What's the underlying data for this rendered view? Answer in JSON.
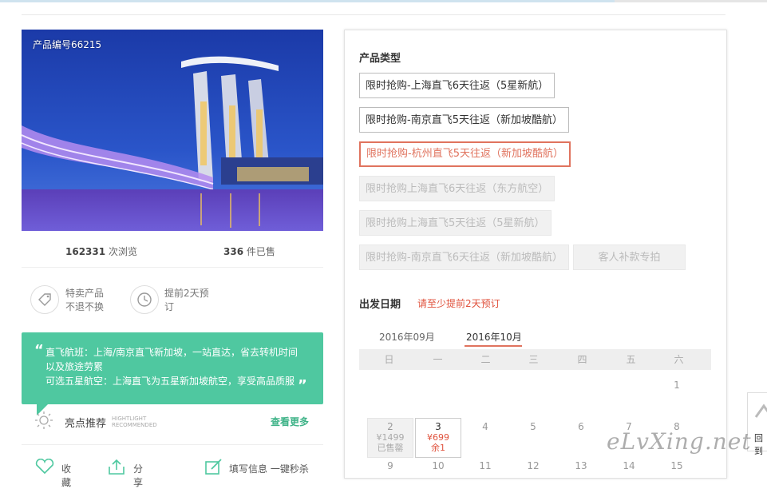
{
  "product": {
    "id_label": "产品编号66215",
    "views_count": "162331",
    "views_unit": "次浏览",
    "sold_count": "336",
    "sold_unit": "件已售"
  },
  "features": [
    {
      "icon": "tag-icon",
      "line1": "特卖产品",
      "line2": "不退不换"
    },
    {
      "icon": "clock-icon",
      "line1": "提前2天预",
      "line2": "订"
    }
  ],
  "highlight_quote": {
    "line1": "直飞航班：上海/南京直飞新加坡，一站直达，省去转机时间",
    "line2": "以及旅途劳累",
    "line3": "可选五星航空：上海直飞为五星新加坡航空，享受高品质服"
  },
  "highlights": {
    "title": "亮点推荐",
    "sub1": "HIGHTLIGHT",
    "sub2": "RECOMMENDED",
    "more_link": "查看更多"
  },
  "bottom_actions": {
    "favorite": "收藏",
    "share": "分享",
    "quick_fill": "填写信息 一键秒杀"
  },
  "product_type": {
    "title": "产品类型",
    "options": [
      {
        "label": "限时抢购-上海直飞6天往返（5星新航）",
        "state": "normal"
      },
      {
        "label": "限时抢购-南京直飞5天往返（新加坡酷航）",
        "state": "normal"
      },
      {
        "label": "限时抢购-杭州直飞5天往返（新加坡酷航）",
        "state": "selected"
      },
      {
        "label": "限时抢购上海直飞6天往返（东方航空）",
        "state": "disabled"
      },
      {
        "label": "限时抢购上海直飞5天往返（5星新航）",
        "state": "disabled"
      },
      {
        "label": "限时抢购-南京直飞6天往返（新加坡酷航）",
        "state": "disabled"
      },
      {
        "label": "客人补款专拍",
        "state": "disabled"
      }
    ]
  },
  "departure": {
    "title": "出发日期",
    "hint": "请至少提前2天预订",
    "months": [
      "2016年09月",
      "2016年10月"
    ],
    "active_month": "2016年10月",
    "weekdays": [
      "日",
      "一",
      "二",
      "三",
      "四",
      "五",
      "六"
    ],
    "row1": [
      "",
      "",
      "",
      "",
      "",
      "",
      "1"
    ],
    "row2": [
      {
        "day": "2",
        "price": "¥1499",
        "status": "已售罄",
        "state": "soldout"
      },
      {
        "day": "3",
        "price": "¥699",
        "status": "余1",
        "state": "available"
      },
      {
        "day": "4"
      },
      {
        "day": "5"
      },
      {
        "day": "6"
      },
      {
        "day": "7"
      },
      {
        "day": "8"
      }
    ],
    "row3": [
      "9",
      "10",
      "11",
      "12",
      "13",
      "14",
      "15"
    ]
  },
  "watermark": "eLvXing.net",
  "side_widget_label": "回到"
}
